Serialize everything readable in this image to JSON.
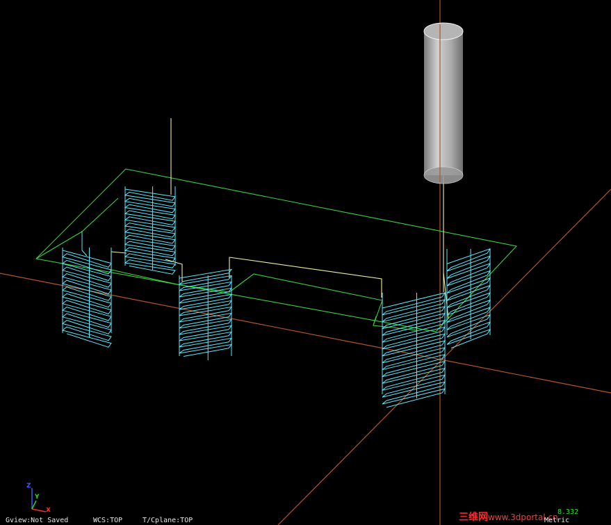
{
  "status_bar": {
    "gview": "Gview:Not Saved",
    "wcs": "WCS:TOP",
    "tplane": "T/Cplane:TOP"
  },
  "coord_readout": "8.332",
  "units": "Metric",
  "watermark": {
    "brand": "三维网",
    "url": "www.3dportal.cn"
  },
  "triad": {
    "z": "Z",
    "y": "Y",
    "x": "X"
  },
  "colors": {
    "background": "#000000",
    "toolpath_cyan": "#5fe8ff",
    "stock_green": "#39d23c",
    "rapid_yellow": "#f0f0a0",
    "axis_orange": "#b4552a",
    "tool_gray": "#c8c8c8"
  }
}
